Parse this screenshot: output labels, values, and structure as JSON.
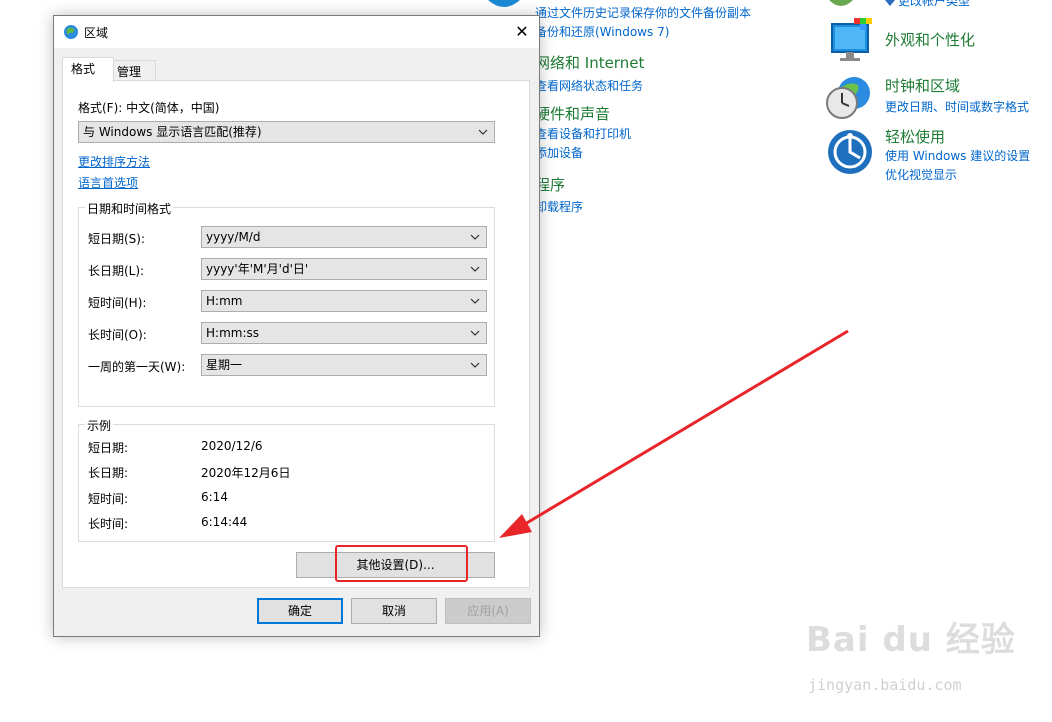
{
  "control_panel": {
    "backup_link1": "通过文件历史记录保存你的文件备份副本",
    "backup_link2": "备份和还原(Windows 7)",
    "network_heading": "网络和 Internet",
    "network_link": "查看网络状态和任务",
    "hardware_heading": "硬件和声音",
    "hardware_link1": "查看设备和打印机",
    "hardware_link2": "添加设备",
    "programs_heading": "程序",
    "programs_link": "卸载程序",
    "account_link": "更改帐户类型",
    "appearance_heading": "外观和个性化",
    "clock_heading": "时钟和区域",
    "clock_link": "更改日期、时间或数字格式",
    "ease_heading": "轻松使用",
    "ease_link1": "使用 Windows 建议的设置",
    "ease_link2": "优化视觉显示"
  },
  "dialog": {
    "title": "区域",
    "close": "✕",
    "tabs": [
      "格式",
      "管理"
    ],
    "format_label": "格式(F): 中文(简体，中国)",
    "format_value": "与 Windows 显示语言匹配(推荐)",
    "sort_link": "更改排序方法",
    "lang_link": "语言首选项",
    "datetime_group": "日期和时间格式",
    "rows": [
      {
        "label": "短日期(S):",
        "value": "yyyy/M/d"
      },
      {
        "label": "长日期(L):",
        "value": "yyyy'年'M'月'd'日'"
      },
      {
        "label": "短时间(H):",
        "value": "H:mm"
      },
      {
        "label": "长时间(O):",
        "value": "H:mm:ss"
      },
      {
        "label": "一周的第一天(W):",
        "value": "星期一"
      }
    ],
    "example_group": "示例",
    "examples": [
      {
        "label": "短日期:",
        "value": "2020/12/6"
      },
      {
        "label": "长日期:",
        "value": "2020年12月6日"
      },
      {
        "label": "短时间:",
        "value": "6:14"
      },
      {
        "label": "长时间:",
        "value": "6:14:44"
      }
    ],
    "more_settings": "其他设置(D)...",
    "ok": "确定",
    "cancel": "取消",
    "apply": "应用(A)"
  },
  "watermark": {
    "brand": "Bai du 经验",
    "url": "jingyan.baidu.com"
  },
  "colors": {
    "link": "#0066cc",
    "heading": "#1e7b34",
    "highlight": "#e8262a",
    "accent": "#0078d7"
  }
}
